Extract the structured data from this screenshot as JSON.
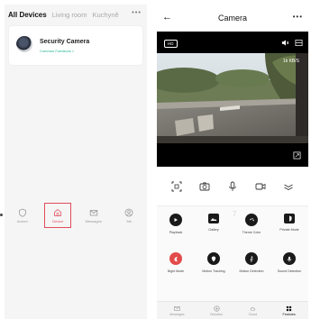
{
  "left_screen": {
    "tabs": [
      {
        "label": "All Devices",
        "active": true
      },
      {
        "label": "Living room",
        "active": false
      },
      {
        "label": "Kuchyně",
        "active": false
      }
    ],
    "more_label": "•••",
    "device": {
      "name": "Security Camera",
      "subtitle": "Common Functions >"
    },
    "nav": [
      {
        "label": "Armed",
        "icon": "shield-icon"
      },
      {
        "label": "Device",
        "icon": "home-icon",
        "highlighted": true
      },
      {
        "label": "Messages",
        "icon": "mail-icon"
      },
      {
        "label": "Me",
        "icon": "user-icon"
      }
    ]
  },
  "right_screen": {
    "title": "Camera",
    "back_label": "←",
    "more_label": "•••",
    "hd_label": "HD",
    "speed": "1k KB/S",
    "toolbar_icons": [
      "screenshot-icon",
      "camera-icon",
      "microphone-icon",
      "video-record-icon",
      "expand-chevrons-icon"
    ],
    "page_indicator": "7",
    "features": [
      {
        "label": "Playback",
        "icon": "play-icon"
      },
      {
        "label": "Gallery",
        "icon": "gallery-icon"
      },
      {
        "label": "Theme Color",
        "icon": "palette-icon"
      },
      {
        "label": "Private Mode",
        "icon": "private-icon"
      },
      {
        "label": "Night Mode",
        "icon": "night-mode-icon",
        "accent": "#e24b4b"
      },
      {
        "label": "Motion Tracking",
        "icon": "location-pin-icon"
      },
      {
        "label": "Motion Detection",
        "icon": "motion-icon"
      },
      {
        "label": "Sound Detection",
        "icon": "sound-icon"
      }
    ],
    "bottom_tabs": [
      {
        "label": "Messages",
        "icon": "message-icon"
      },
      {
        "label": "Direction",
        "icon": "direction-icon"
      },
      {
        "label": "Cloud",
        "icon": "cloud-icon"
      },
      {
        "label": "Features",
        "icon": "grid-icon",
        "active": true
      }
    ]
  }
}
